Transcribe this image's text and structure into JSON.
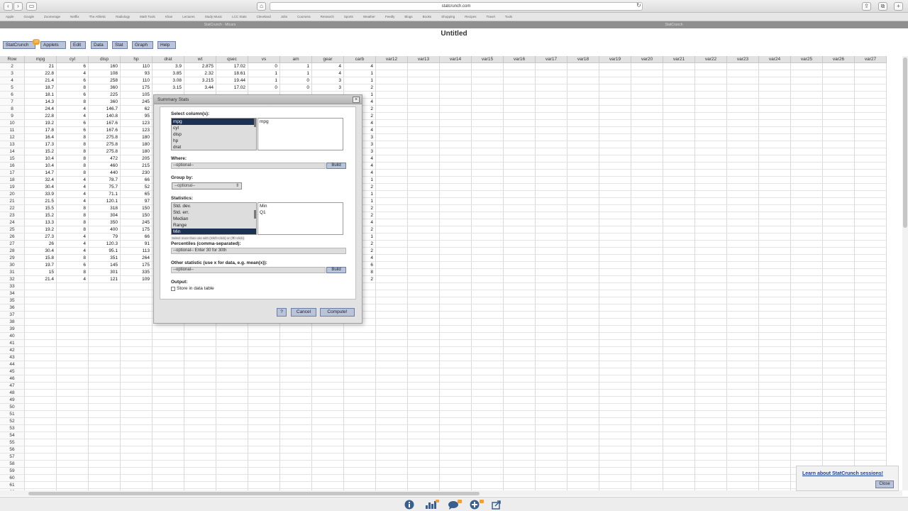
{
  "browser": {
    "url": "statcrunch.com",
    "bookmarks": [
      "Apple",
      "Google",
      "Zoomerage",
      "Netflix",
      "The Athletic",
      "Radiology",
      "Math Tools",
      "Khan",
      "Lectures",
      "Study Music",
      "LCC Stats",
      "Cleveland",
      "Jobs",
      "Coursera",
      "Research",
      "Sports",
      "Weather",
      "Feedly",
      "Blogs",
      "Books",
      "Shopping",
      "Recipes",
      "Travel",
      "Tools"
    ],
    "tabs": [
      "StatCrunch - Mtcars",
      "StatCrunch"
    ]
  },
  "doc_title": "Untitled",
  "menu": {
    "items": [
      "StatCrunch",
      "Applets",
      "Edit",
      "Data",
      "Stat",
      "Graph",
      "Help"
    ],
    "badge": "10"
  },
  "grid": {
    "columns": [
      "Row",
      "mpg",
      "cyl",
      "disp",
      "hp",
      "drat",
      "wt",
      "qsec",
      "vs",
      "am",
      "gear",
      "carb",
      "var12",
      "var13",
      "var14",
      "var15",
      "var16",
      "var17",
      "var18",
      "var19",
      "var20",
      "var21",
      "var22",
      "var23",
      "var24",
      "var25",
      "var26",
      "var27"
    ],
    "rows": [
      [
        "2",
        "21",
        "6",
        "160",
        "110",
        "3.9",
        "2.875",
        "17.02",
        "0",
        "1",
        "4",
        "4"
      ],
      [
        "3",
        "22.8",
        "4",
        "108",
        "93",
        "3.85",
        "2.32",
        "18.61",
        "1",
        "1",
        "4",
        "1"
      ],
      [
        "4",
        "21.4",
        "6",
        "258",
        "110",
        "3.08",
        "3.215",
        "19.44",
        "1",
        "0",
        "3",
        "1"
      ],
      [
        "5",
        "18.7",
        "8",
        "360",
        "175",
        "3.15",
        "3.44",
        "17.02",
        "0",
        "0",
        "3",
        "2"
      ],
      [
        "6",
        "18.1",
        "6",
        "225",
        "105",
        "",
        "",
        "",
        "",
        "",
        "",
        "1"
      ],
      [
        "7",
        "14.3",
        "8",
        "360",
        "245",
        "",
        "",
        "",
        "",
        "",
        "",
        "4"
      ],
      [
        "8",
        "24.4",
        "4",
        "146.7",
        "62",
        "",
        "",
        "",
        "",
        "",
        "",
        "2"
      ],
      [
        "9",
        "22.8",
        "4",
        "140.8",
        "95",
        "",
        "",
        "",
        "",
        "",
        "",
        "2"
      ],
      [
        "10",
        "19.2",
        "6",
        "167.6",
        "123",
        "",
        "",
        "",
        "",
        "",
        "",
        "4"
      ],
      [
        "11",
        "17.8",
        "6",
        "167.6",
        "123",
        "",
        "",
        "",
        "",
        "",
        "",
        "4"
      ],
      [
        "12",
        "16.4",
        "8",
        "275.8",
        "180",
        "",
        "",
        "",
        "",
        "",
        "",
        "3"
      ],
      [
        "13",
        "17.3",
        "8",
        "275.8",
        "180",
        "",
        "",
        "",
        "",
        "",
        "",
        "3"
      ],
      [
        "14",
        "15.2",
        "8",
        "275.8",
        "180",
        "",
        "",
        "",
        "",
        "",
        "",
        "3"
      ],
      [
        "15",
        "10.4",
        "8",
        "472",
        "205",
        "",
        "",
        "",
        "",
        "",
        "",
        "4"
      ],
      [
        "16",
        "10.4",
        "8",
        "460",
        "215",
        "",
        "",
        "",
        "",
        "",
        "",
        "4"
      ],
      [
        "17",
        "14.7",
        "8",
        "440",
        "230",
        "",
        "",
        "",
        "",
        "",
        "",
        "4"
      ],
      [
        "18",
        "32.4",
        "4",
        "78.7",
        "66",
        "",
        "",
        "",
        "",
        "",
        "",
        "1"
      ],
      [
        "19",
        "30.4",
        "4",
        "75.7",
        "52",
        "",
        "",
        "",
        "",
        "",
        "",
        "2"
      ],
      [
        "20",
        "33.9",
        "4",
        "71.1",
        "65",
        "",
        "",
        "",
        "",
        "",
        "",
        "1"
      ],
      [
        "21",
        "21.5",
        "4",
        "120.1",
        "97",
        "",
        "",
        "",
        "",
        "",
        "",
        "1"
      ],
      [
        "22",
        "15.5",
        "8",
        "318",
        "150",
        "",
        "",
        "",
        "",
        "",
        "",
        "2"
      ],
      [
        "23",
        "15.2",
        "8",
        "304",
        "150",
        "",
        "",
        "",
        "",
        "",
        "",
        "2"
      ],
      [
        "24",
        "13.3",
        "8",
        "350",
        "245",
        "",
        "",
        "",
        "",
        "",
        "",
        "4"
      ],
      [
        "25",
        "19.2",
        "8",
        "400",
        "175",
        "",
        "",
        "",
        "",
        "",
        "",
        "2"
      ],
      [
        "26",
        "27.3",
        "4",
        "79",
        "66",
        "",
        "",
        "",
        "",
        "",
        "",
        "1"
      ],
      [
        "27",
        "26",
        "4",
        "120.3",
        "91",
        "",
        "",
        "",
        "",
        "",
        "",
        "2"
      ],
      [
        "28",
        "30.4",
        "4",
        "95.1",
        "113",
        "",
        "",
        "",
        "",
        "",
        "",
        "2"
      ],
      [
        "29",
        "15.8",
        "8",
        "351",
        "264",
        "",
        "",
        "",
        "",
        "",
        "",
        "4"
      ],
      [
        "30",
        "19.7",
        "6",
        "145",
        "175",
        "",
        "",
        "",
        "",
        "",
        "",
        "6"
      ],
      [
        "31",
        "15",
        "8",
        "301",
        "335",
        "",
        "",
        "",
        "",
        "",
        "",
        "8"
      ],
      [
        "32",
        "21.4",
        "4",
        "121",
        "109",
        "",
        "",
        "",
        "",
        "",
        "",
        "2"
      ],
      [
        "33"
      ],
      [
        "34"
      ],
      [
        "35"
      ],
      [
        "36"
      ],
      [
        "37"
      ],
      [
        "38"
      ],
      [
        "39"
      ],
      [
        "40"
      ],
      [
        "41"
      ],
      [
        "42"
      ],
      [
        "43"
      ],
      [
        "44"
      ],
      [
        "45"
      ],
      [
        "46"
      ],
      [
        "47"
      ],
      [
        "48"
      ],
      [
        "49"
      ],
      [
        "50"
      ],
      [
        "51"
      ],
      [
        "52"
      ],
      [
        "53"
      ],
      [
        "54"
      ],
      [
        "55"
      ],
      [
        "56"
      ],
      [
        "57"
      ],
      [
        "58"
      ],
      [
        "59"
      ],
      [
        "60"
      ],
      [
        "61"
      ],
      [
        "62"
      ]
    ]
  },
  "dialog": {
    "title": "Summary Stats",
    "close_label": "×",
    "select_columns_label": "Select column(s):",
    "columns_list": [
      "mpg",
      "cyl",
      "disp",
      "hp",
      "drat"
    ],
    "selected_columns": [
      "mpg"
    ],
    "where_label": "Where:",
    "where_placeholder": "--optional--",
    "build_label": "Build",
    "group_by_label": "Group by:",
    "group_by_value": "--optional--",
    "statistics_label": "Statistics:",
    "stats_list": [
      "Std. dev.",
      "Std. err.",
      "Median",
      "Range",
      "Min"
    ],
    "selected_stats": [
      "Min",
      "Q1"
    ],
    "hint": "Select more than one with (Shift+click) or (⌘+click)",
    "percentiles_label": "Percentiles (comma-separated):",
    "percentiles_placeholder": "--optional-- Enter 30 for 30th",
    "other_stat_label": "Other statistic (use x for data, e.g. mean(x)):",
    "other_stat_placeholder": "--optional--",
    "output_label": "Output:",
    "store_label": "Store in data table",
    "help_label": "?",
    "cancel_label": "Cancel",
    "compute_label": "Compute!"
  },
  "sessions_popup": {
    "link": "Learn about StatCrunch sessions!",
    "close": "Close"
  },
  "bottom_icons": [
    "info-icon",
    "chart-icon",
    "chat-icon",
    "add-icon",
    "share-icon"
  ],
  "colors": {
    "button_fill": "#b9c4d8",
    "selection": "#1c3052",
    "link": "#1a3fa0"
  }
}
